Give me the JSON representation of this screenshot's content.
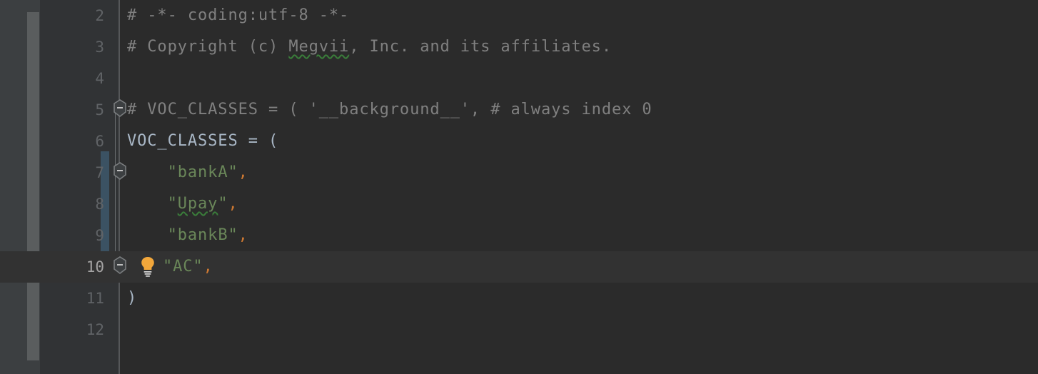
{
  "editor": {
    "theme_name": "darcula",
    "colors": {
      "background": "#2b2b2b",
      "gutter_background": "#313335",
      "left_panel": "#3c3f41",
      "scrollbar_thumb": "#5a5d5e",
      "current_line": "#323232",
      "selection_bar": "#3b5263",
      "line_number": "#606366",
      "line_number_current": "#a4a3a3",
      "comment": "#808080",
      "identifier": "#a9b7c6",
      "string": "#6a8759",
      "comma": "#cc7832",
      "typo_underline": "#3a7d3a",
      "bulb": "#f2a73b"
    },
    "current_line_number": 10,
    "first_visible_line": 2,
    "last_visible_line": 12,
    "lines": [
      {
        "number": "2",
        "fold": null,
        "bulb": false,
        "current": false,
        "tokens": [
          {
            "text": "# -*- coding:utf-8 -*-",
            "kind": "comment"
          }
        ]
      },
      {
        "number": "3",
        "fold": null,
        "bulb": false,
        "current": false,
        "tokens": [
          {
            "text": "# Copyright (c) ",
            "kind": "comment"
          },
          {
            "text": "Megvii",
            "kind": "comment-typo"
          },
          {
            "text": ", Inc. and its affiliates.",
            "kind": "comment"
          }
        ]
      },
      {
        "number": "4",
        "fold": null,
        "bulb": false,
        "current": false,
        "tokens": []
      },
      {
        "number": "5",
        "fold": "collapse",
        "bulb": false,
        "current": false,
        "tokens": [
          {
            "text": "# VOC_CLASSES = ( '__background__', # always index 0",
            "kind": "comment"
          }
        ]
      },
      {
        "number": "6",
        "fold": null,
        "bulb": false,
        "current": false,
        "tokens": [
          {
            "text": "VOC_CLASSES",
            "kind": "identifier"
          },
          {
            "text": " = (",
            "kind": "punctuation"
          }
        ]
      },
      {
        "number": "7",
        "fold": "collapse",
        "bulb": false,
        "current": false,
        "tokens": [
          {
            "text": "    ",
            "kind": "plain"
          },
          {
            "text": "\"bankA\"",
            "kind": "string"
          },
          {
            "text": ",",
            "kind": "comma"
          }
        ]
      },
      {
        "number": "8",
        "fold": null,
        "bulb": false,
        "current": false,
        "tokens": [
          {
            "text": "    ",
            "kind": "plain"
          },
          {
            "text": "\"",
            "kind": "string"
          },
          {
            "text": "Upay",
            "kind": "string-typo"
          },
          {
            "text": "\"",
            "kind": "string"
          },
          {
            "text": ",",
            "kind": "comma"
          }
        ]
      },
      {
        "number": "9",
        "fold": null,
        "bulb": false,
        "current": false,
        "tokens": [
          {
            "text": "    ",
            "kind": "plain"
          },
          {
            "text": "\"bankB\"",
            "kind": "string"
          },
          {
            "text": ",",
            "kind": "comma"
          }
        ]
      },
      {
        "number": "10",
        "fold": "collapse",
        "bulb": true,
        "current": true,
        "tokens": [
          {
            "text": "    ",
            "kind": "plain"
          },
          {
            "text": "\"AC\"",
            "kind": "string"
          },
          {
            "text": ",",
            "kind": "comma"
          }
        ]
      },
      {
        "number": "11",
        "fold": null,
        "bulb": false,
        "current": false,
        "tokens": [
          {
            "text": ")",
            "kind": "punctuation"
          }
        ]
      },
      {
        "number": "12",
        "fold": null,
        "bulb": false,
        "current": false,
        "tokens": []
      }
    ],
    "icons": {
      "fold_collapse": "fold-collapse-icon",
      "intention_bulb": "intention-bulb-icon",
      "scrollbar": "vertical-scrollbar"
    }
  }
}
